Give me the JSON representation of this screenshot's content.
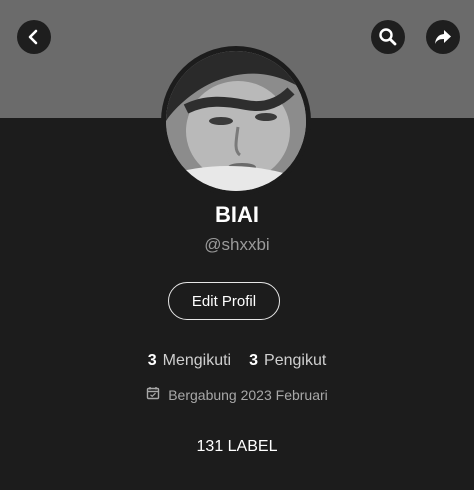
{
  "profile": {
    "name": "BIAI",
    "handle": "@shxxbi",
    "edit_label": "Edit Profil",
    "following_count": "3",
    "following_label": "Mengikuti",
    "followers_count": "3",
    "followers_label": "Pengikut",
    "joined_text": "Bergabung 2023 Februari",
    "label_count_text": "131 LABEL"
  },
  "icons": {
    "back": "chevron-left-icon",
    "search": "search-icon",
    "share": "share-arrow-icon",
    "calendar": "calendar-icon"
  },
  "colors": {
    "cover": "#6b6b6b",
    "background": "#1c1c1c",
    "text_primary": "#ffffff",
    "text_secondary": "#9a9a9a"
  }
}
